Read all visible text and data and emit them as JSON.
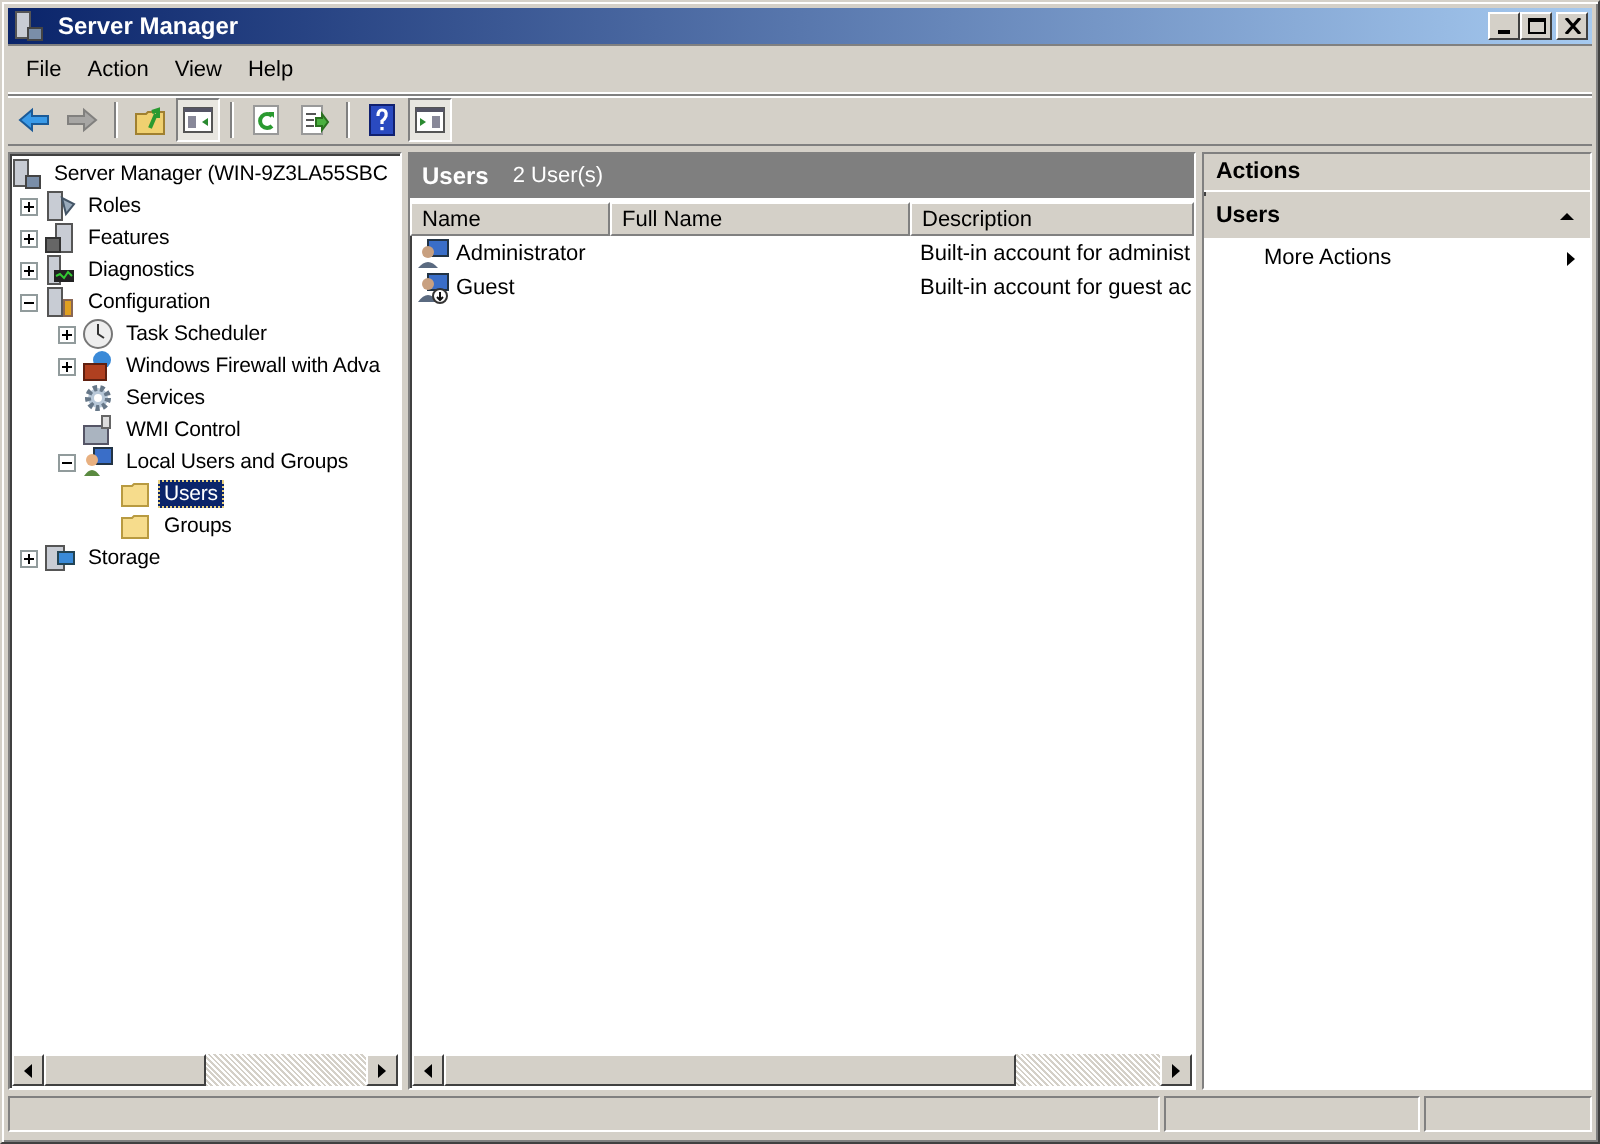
{
  "window": {
    "title": "Server Manager"
  },
  "menu": [
    "File",
    "Action",
    "View",
    "Help"
  ],
  "toolbar": [
    {
      "kind": "back",
      "disabled": false
    },
    {
      "kind": "forward",
      "disabled": true
    },
    {
      "kind": "sep"
    },
    {
      "kind": "up",
      "disabled": false
    },
    {
      "kind": "tree",
      "disabled": false,
      "selected": true
    },
    {
      "kind": "sep"
    },
    {
      "kind": "refresh",
      "disabled": false
    },
    {
      "kind": "export",
      "disabled": false
    },
    {
      "kind": "sep"
    },
    {
      "kind": "help",
      "disabled": false
    },
    {
      "kind": "pane",
      "disabled": false,
      "selected": true
    }
  ],
  "tree": [
    {
      "label": "Server Manager (WIN-9Z3LA55SBC",
      "kind": "server",
      "selected": false,
      "children": [
        {
          "label": "Roles",
          "kind": "roles",
          "expanded": false,
          "selected": false
        },
        {
          "label": "Features",
          "kind": "features",
          "expanded": false,
          "selected": false
        },
        {
          "label": "Diagnostics",
          "kind": "diagnostics",
          "expanded": false,
          "selected": false
        },
        {
          "label": "Configuration",
          "kind": "config",
          "expanded": true,
          "selected": false,
          "children": [
            {
              "label": "Task Scheduler",
              "kind": "clock",
              "expanded": false,
              "selected": false
            },
            {
              "label": "Windows Firewall with Adva",
              "kind": "firewall",
              "expanded": false,
              "selected": false
            },
            {
              "label": "Services",
              "kind": "gear",
              "selected": false
            },
            {
              "label": "WMI Control",
              "kind": "wmi",
              "selected": false
            },
            {
              "label": "Local Users and Groups",
              "kind": "users",
              "expanded": true,
              "selected": false,
              "children": [
                {
                  "label": "Users",
                  "kind": "folder",
                  "selected": true
                },
                {
                  "label": "Groups",
                  "kind": "folder",
                  "selected": false
                }
              ]
            }
          ]
        },
        {
          "label": "Storage",
          "kind": "storage",
          "expanded": false,
          "selected": false
        }
      ]
    }
  ],
  "center": {
    "title": "Users",
    "count": "2 User(s)",
    "columns": [
      "Name",
      "Full Name",
      "Description"
    ],
    "rows": [
      {
        "kind": "admin",
        "name": "Administrator",
        "full_name": "",
        "description": "Built-in account for administ"
      },
      {
        "kind": "guest",
        "name": "Guest",
        "full_name": "",
        "description": "Built-in account for guest ac"
      }
    ]
  },
  "actions": {
    "title": "Actions",
    "section": "Users",
    "expanded": true,
    "items": [
      "More Actions"
    ]
  }
}
